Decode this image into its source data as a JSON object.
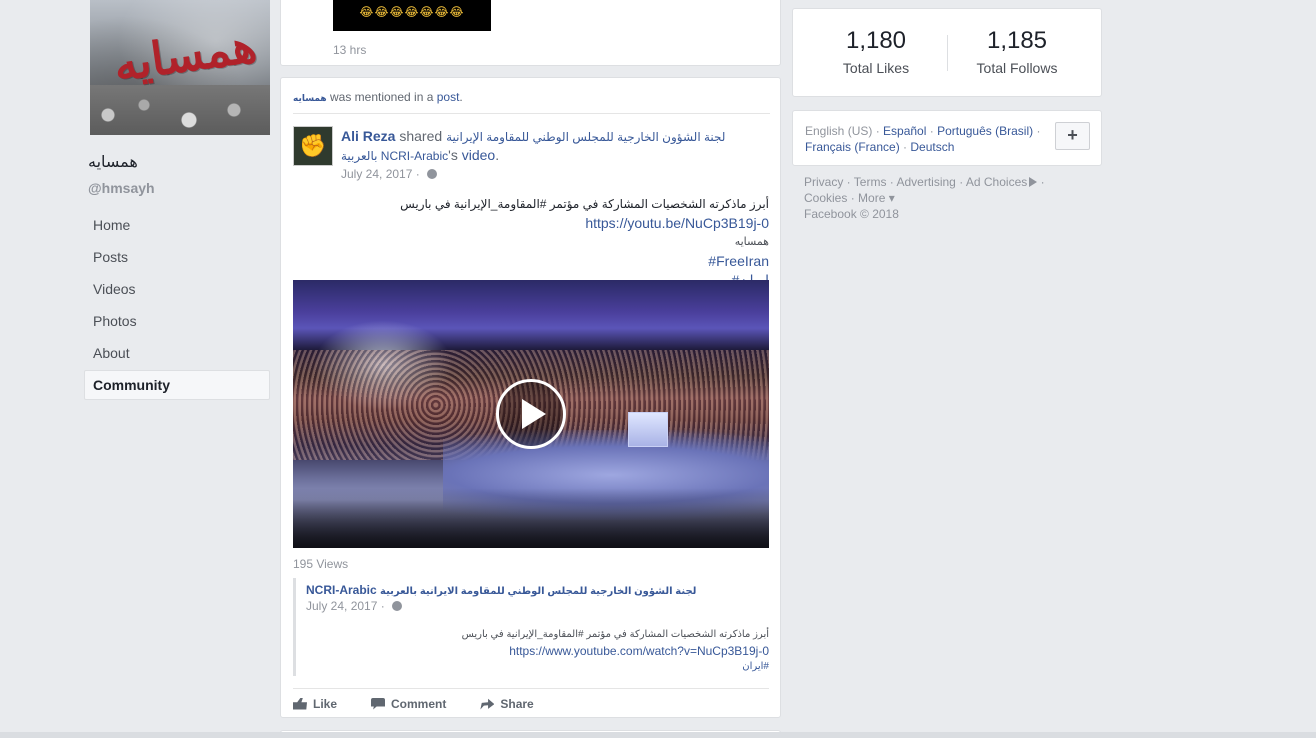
{
  "page": {
    "name": "همسایه",
    "handle": "@hmsayh",
    "cover_text": "همسایه"
  },
  "nav": {
    "items": [
      "Home",
      "Posts",
      "Videos",
      "Photos",
      "About",
      "Community"
    ],
    "active": "Community"
  },
  "prev_post": {
    "emoji": "😂😂😂😂😂😂😂",
    "time": "13 hrs"
  },
  "post": {
    "mention": {
      "page_name": "همسایه",
      "text_a": " was mentioned in a ",
      "post_link": "post",
      "text_b": "."
    },
    "author": "Ali Reza",
    "shared_word": " shared ",
    "shared_page": "لجنة الشؤون الخارجية للمجلس الوطني للمقاومة الإيرانية بالعربية NCRI-Arabic",
    "shared_suffix": "'s ",
    "video_word": "video",
    "date": "July 24, 2017 · ",
    "text_lines": {
      "line1": "أبرز ماذكرته الشخصيات المشاركة في مؤتمر #المقاومة_الإيرانية في باريس",
      "line2": "https://youtu.be/NuCp3B19j-0",
      "line3": "همسایه",
      "line4": "#FreeIran",
      "line5": "#ایران"
    },
    "views": "195 Views",
    "shared": {
      "title_ar": "لجنة الشؤون الخارجية للمجلس الوطني للمقاومة الايرانية بالعربية",
      "title_en": "NCRI-Arabic ",
      "date": "July 24, 2017 · ",
      "line1": "أبرز ماذكرته الشخصيات المشاركة في مؤتمر #المقاومة_الإيرانية في باريس",
      "line2": "https://www.youtube.com/watch?v=NuCp3B19j-0",
      "line3": "#ایران"
    },
    "actions": {
      "like": "Like",
      "comment": "Comment",
      "share": "Share"
    }
  },
  "stats": {
    "likes_count": "1,180",
    "likes_label": "Total Likes",
    "follows_count": "1,185",
    "follows_label": "Total Follows"
  },
  "languages": {
    "current": "English (US)",
    "others": [
      "Español",
      "Português (Brasil)",
      "Français (France)",
      "Deutsch"
    ],
    "sep": " · ",
    "add": "+"
  },
  "footer": {
    "links": [
      "Privacy",
      "Terms",
      "Advertising",
      "Ad Choices",
      "Cookies",
      "More"
    ],
    "sep": " · ",
    "more_caret": " ▾",
    "copyright": "Facebook © 2018"
  },
  "colors": {
    "link": "#385898",
    "background": "#e9ebee",
    "muted": "#90949c"
  }
}
